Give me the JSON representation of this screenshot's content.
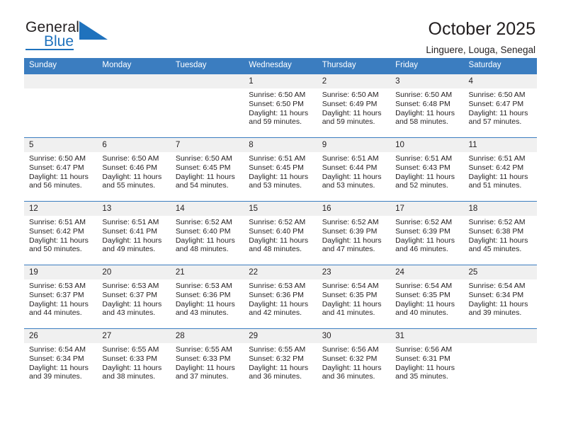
{
  "brand": {
    "name_part1": "General",
    "name_part2": "Blue",
    "accent_color": "#1f72bd",
    "logo_icon": "blue-triangle-icon"
  },
  "header": {
    "title": "October 2025",
    "subtitle": "Linguere, Louga, Senegal"
  },
  "calendar": {
    "header_bg": "#3b7dc0",
    "daynum_band_bg": "#f0f0f0",
    "weekdays": [
      "Sunday",
      "Monday",
      "Tuesday",
      "Wednesday",
      "Thursday",
      "Friday",
      "Saturday"
    ],
    "weeks": [
      [
        {
          "day": "",
          "lines": []
        },
        {
          "day": "",
          "lines": []
        },
        {
          "day": "",
          "lines": []
        },
        {
          "day": "1",
          "lines": [
            "Sunrise: 6:50 AM",
            "Sunset: 6:50 PM",
            "Daylight: 11 hours and 59 minutes."
          ]
        },
        {
          "day": "2",
          "lines": [
            "Sunrise: 6:50 AM",
            "Sunset: 6:49 PM",
            "Daylight: 11 hours and 59 minutes."
          ]
        },
        {
          "day": "3",
          "lines": [
            "Sunrise: 6:50 AM",
            "Sunset: 6:48 PM",
            "Daylight: 11 hours and 58 minutes."
          ]
        },
        {
          "day": "4",
          "lines": [
            "Sunrise: 6:50 AM",
            "Sunset: 6:47 PM",
            "Daylight: 11 hours and 57 minutes."
          ]
        }
      ],
      [
        {
          "day": "5",
          "lines": [
            "Sunrise: 6:50 AM",
            "Sunset: 6:47 PM",
            "Daylight: 11 hours and 56 minutes."
          ]
        },
        {
          "day": "6",
          "lines": [
            "Sunrise: 6:50 AM",
            "Sunset: 6:46 PM",
            "Daylight: 11 hours and 55 minutes."
          ]
        },
        {
          "day": "7",
          "lines": [
            "Sunrise: 6:50 AM",
            "Sunset: 6:45 PM",
            "Daylight: 11 hours and 54 minutes."
          ]
        },
        {
          "day": "8",
          "lines": [
            "Sunrise: 6:51 AM",
            "Sunset: 6:45 PM",
            "Daylight: 11 hours and 53 minutes."
          ]
        },
        {
          "day": "9",
          "lines": [
            "Sunrise: 6:51 AM",
            "Sunset: 6:44 PM",
            "Daylight: 11 hours and 53 minutes."
          ]
        },
        {
          "day": "10",
          "lines": [
            "Sunrise: 6:51 AM",
            "Sunset: 6:43 PM",
            "Daylight: 11 hours and 52 minutes."
          ]
        },
        {
          "day": "11",
          "lines": [
            "Sunrise: 6:51 AM",
            "Sunset: 6:42 PM",
            "Daylight: 11 hours and 51 minutes."
          ]
        }
      ],
      [
        {
          "day": "12",
          "lines": [
            "Sunrise: 6:51 AM",
            "Sunset: 6:42 PM",
            "Daylight: 11 hours and 50 minutes."
          ]
        },
        {
          "day": "13",
          "lines": [
            "Sunrise: 6:51 AM",
            "Sunset: 6:41 PM",
            "Daylight: 11 hours and 49 minutes."
          ]
        },
        {
          "day": "14",
          "lines": [
            "Sunrise: 6:52 AM",
            "Sunset: 6:40 PM",
            "Daylight: 11 hours and 48 minutes."
          ]
        },
        {
          "day": "15",
          "lines": [
            "Sunrise: 6:52 AM",
            "Sunset: 6:40 PM",
            "Daylight: 11 hours and 48 minutes."
          ]
        },
        {
          "day": "16",
          "lines": [
            "Sunrise: 6:52 AM",
            "Sunset: 6:39 PM",
            "Daylight: 11 hours and 47 minutes."
          ]
        },
        {
          "day": "17",
          "lines": [
            "Sunrise: 6:52 AM",
            "Sunset: 6:39 PM",
            "Daylight: 11 hours and 46 minutes."
          ]
        },
        {
          "day": "18",
          "lines": [
            "Sunrise: 6:52 AM",
            "Sunset: 6:38 PM",
            "Daylight: 11 hours and 45 minutes."
          ]
        }
      ],
      [
        {
          "day": "19",
          "lines": [
            "Sunrise: 6:53 AM",
            "Sunset: 6:37 PM",
            "Daylight: 11 hours and 44 minutes."
          ]
        },
        {
          "day": "20",
          "lines": [
            "Sunrise: 6:53 AM",
            "Sunset: 6:37 PM",
            "Daylight: 11 hours and 43 minutes."
          ]
        },
        {
          "day": "21",
          "lines": [
            "Sunrise: 6:53 AM",
            "Sunset: 6:36 PM",
            "Daylight: 11 hours and 43 minutes."
          ]
        },
        {
          "day": "22",
          "lines": [
            "Sunrise: 6:53 AM",
            "Sunset: 6:36 PM",
            "Daylight: 11 hours and 42 minutes."
          ]
        },
        {
          "day": "23",
          "lines": [
            "Sunrise: 6:54 AM",
            "Sunset: 6:35 PM",
            "Daylight: 11 hours and 41 minutes."
          ]
        },
        {
          "day": "24",
          "lines": [
            "Sunrise: 6:54 AM",
            "Sunset: 6:35 PM",
            "Daylight: 11 hours and 40 minutes."
          ]
        },
        {
          "day": "25",
          "lines": [
            "Sunrise: 6:54 AM",
            "Sunset: 6:34 PM",
            "Daylight: 11 hours and 39 minutes."
          ]
        }
      ],
      [
        {
          "day": "26",
          "lines": [
            "Sunrise: 6:54 AM",
            "Sunset: 6:34 PM",
            "Daylight: 11 hours and 39 minutes."
          ]
        },
        {
          "day": "27",
          "lines": [
            "Sunrise: 6:55 AM",
            "Sunset: 6:33 PM",
            "Daylight: 11 hours and 38 minutes."
          ]
        },
        {
          "day": "28",
          "lines": [
            "Sunrise: 6:55 AM",
            "Sunset: 6:33 PM",
            "Daylight: 11 hours and 37 minutes."
          ]
        },
        {
          "day": "29",
          "lines": [
            "Sunrise: 6:55 AM",
            "Sunset: 6:32 PM",
            "Daylight: 11 hours and 36 minutes."
          ]
        },
        {
          "day": "30",
          "lines": [
            "Sunrise: 6:56 AM",
            "Sunset: 6:32 PM",
            "Daylight: 11 hours and 36 minutes."
          ]
        },
        {
          "day": "31",
          "lines": [
            "Sunrise: 6:56 AM",
            "Sunset: 6:31 PM",
            "Daylight: 11 hours and 35 minutes."
          ]
        },
        {
          "day": "",
          "lines": []
        }
      ]
    ]
  }
}
